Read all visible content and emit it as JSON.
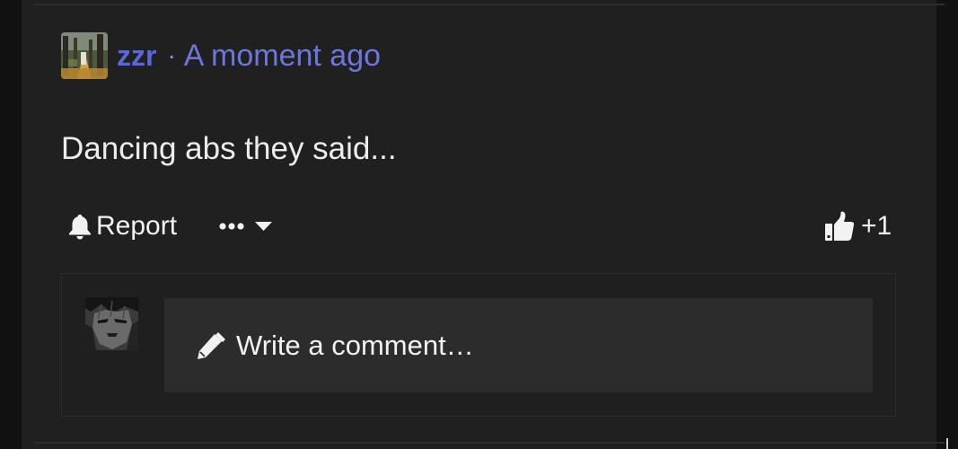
{
  "comment": {
    "username": "zzr",
    "separator": "·",
    "timestamp": "A moment ago",
    "text": "Dancing abs they said...",
    "avatar_icon": "forest-path-avatar"
  },
  "actions": {
    "report_label": "Report",
    "report_icon": "bell-icon",
    "more_icon": "ellipsis-dropdown-icon",
    "like_icon": "thumbs-up-icon",
    "like_count": "+1"
  },
  "reply": {
    "placeholder": "Write a comment…",
    "pencil_icon": "pencil-icon",
    "avatar_icon": "manga-character-avatar"
  },
  "colors": {
    "username": "#5a67d8",
    "timestamp": "#6b77dd",
    "card_bg": "#202020",
    "input_bg": "#2c2c2c",
    "text": "#ececec"
  }
}
